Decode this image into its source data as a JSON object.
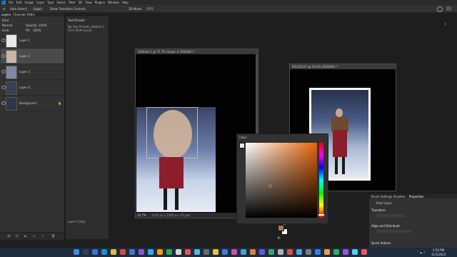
{
  "app": {
    "logo": "Ps",
    "accent": "#31a8ff"
  },
  "menu": [
    "File",
    "Edit",
    "Image",
    "Layer",
    "Type",
    "Select",
    "Filter",
    "3D",
    "View",
    "Plugins",
    "Window",
    "Help"
  ],
  "options_bar": {
    "auto_select": "Auto-Select:",
    "target": "Layer",
    "transform": "Show Transform Controls",
    "mode": "3D Mode:"
  },
  "panel_tabs": [
    "Layers",
    "Channels",
    "Paths"
  ],
  "layers_panel": {
    "search": "Kind",
    "blend_mode": "Normal",
    "opacity_label": "Opacity:",
    "opacity": "100%",
    "lock_label": "Lock:",
    "fill_label": "Fill:",
    "fill": "100%",
    "layers": [
      {
        "name": "Layer 1",
        "thumb": "#e8e8e8",
        "selected": false
      },
      {
        "name": "Layer 2",
        "thumb": "#c9b6a6",
        "selected": true
      },
      {
        "name": "Layer 3",
        "thumb": "#7d8aa6",
        "selected": false
      },
      {
        "name": "Layer 4",
        "thumb": "#3a4052",
        "selected": false
      },
      {
        "name": "Background",
        "thumb": "#2f3648",
        "selected": false
      }
    ]
  },
  "history_panel": {
    "title": "Text Presets",
    "message": "No Text Presets (Added in Ctrl+Shift+Lock)",
    "footer": "Layer Comp"
  },
  "doc1": {
    "title": "Untitled-1 @ 73.7% (Layer 2, RGB/8#) *",
    "status": "33.7%",
    "status_info": "1000 px x 1500 px (72 ppi)"
  },
  "doc2": {
    "title": "DSC05127 @ 16.4% (RGB/8#) *"
  },
  "color_picker": {
    "title": "Color"
  },
  "right_panel": {
    "tabs": [
      "Brush Settings",
      "Brushes",
      "Properties"
    ],
    "section": "Pixel Layer",
    "transform": "Transform",
    "align": "Align and Distribute",
    "quick": "Quick Actions"
  },
  "taskbar": {
    "time": "2:50 PM",
    "date": "11/1/2023"
  }
}
